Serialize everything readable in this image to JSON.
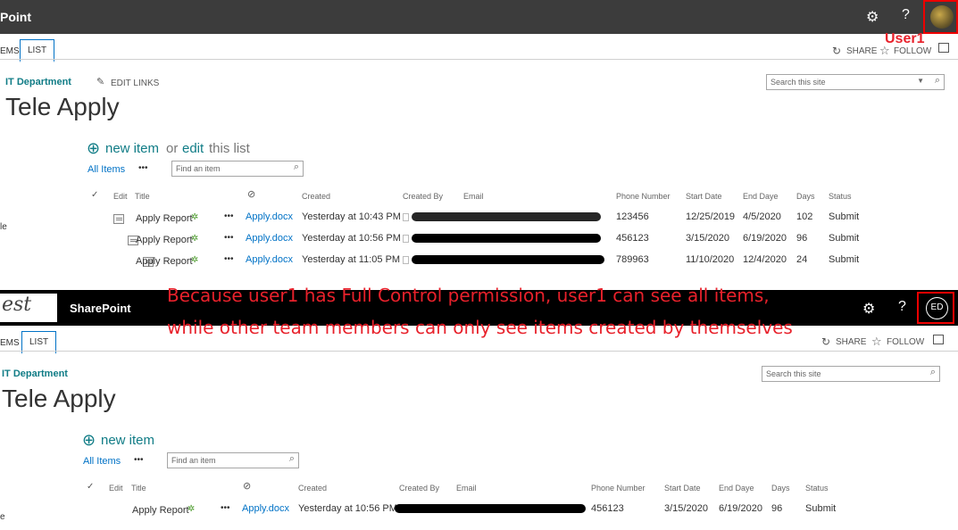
{
  "screen1": {
    "brand": "Point",
    "tabs": [
      "EMS",
      "LIST"
    ],
    "user_label": "User1",
    "actions": {
      "share": "SHARE",
      "follow": "FOLLOW"
    },
    "site_link": "IT Department",
    "edit_links": "EDIT LINKS",
    "search_placeholder": "Search this site",
    "title": "Tele Apply",
    "new_item": "new item",
    "or_edit": "or",
    "edit": "edit",
    "this_list": "this list",
    "all_items": "All Items",
    "more": "•••",
    "find_placeholder": "Find an item",
    "side_fragment": "le",
    "columns": [
      "Edit",
      "Title",
      "Created",
      "Created By",
      "Email",
      "Phone Number",
      "Start Date",
      "End Daye",
      "Days",
      "Status"
    ],
    "rows": [
      {
        "title": "Apply Report",
        "attachment": "Apply.docx",
        "created": "Yesterday at 10:43 PM",
        "phone": "123456",
        "start": "12/25/2019",
        "end": "4/5/2020",
        "days": "102",
        "status": "Submit"
      },
      {
        "title": "Apply Report",
        "attachment": "Apply.docx",
        "created": "Yesterday at 10:56 PM",
        "phone": "456123",
        "start": "3/15/2020",
        "end": "6/19/2020",
        "days": "96",
        "status": "Submit"
      },
      {
        "title": "Apply Report",
        "attachment": "Apply.docx",
        "created": "Yesterday at 11:05 PM",
        "phone": "789963",
        "start": "11/10/2020",
        "end": "12/4/2020",
        "days": "24",
        "status": "Submit"
      }
    ]
  },
  "annotation": {
    "line1": "Because user1 has Full Control permission, user1 can see all items,",
    "line2": "while other team members can only see items created by themselves"
  },
  "screen2": {
    "logo_fragment": "est",
    "brand": "SharePoint",
    "avatar": "ED",
    "tabs": [
      "EMS",
      "LIST"
    ],
    "actions": {
      "share": "SHARE",
      "follow": "FOLLOW"
    },
    "site_link": "IT Department",
    "search_placeholder": "Search this site",
    "title": "Tele Apply",
    "new_item": "new item",
    "all_items": "All Items",
    "more": "•••",
    "find_placeholder": "Find an item",
    "side_fragment": "e",
    "columns": [
      "Edit",
      "Title",
      "Created",
      "Created By",
      "Email",
      "Phone Number",
      "Start Date",
      "End Daye",
      "Days",
      "Status"
    ],
    "rows": [
      {
        "title": "Apply Report",
        "attachment": "Apply.docx",
        "created": "Yesterday at 10:56 PM",
        "phone": "456123",
        "start": "3/15/2020",
        "end": "6/19/2020",
        "days": "96",
        "status": "Submit"
      }
    ]
  },
  "colors": {
    "annotation": "#e8212b",
    "suite_bar_1": "#3c3c3c",
    "suite_bar_2": "#000000",
    "link": "#0072c6",
    "site_link": "#107c86"
  }
}
